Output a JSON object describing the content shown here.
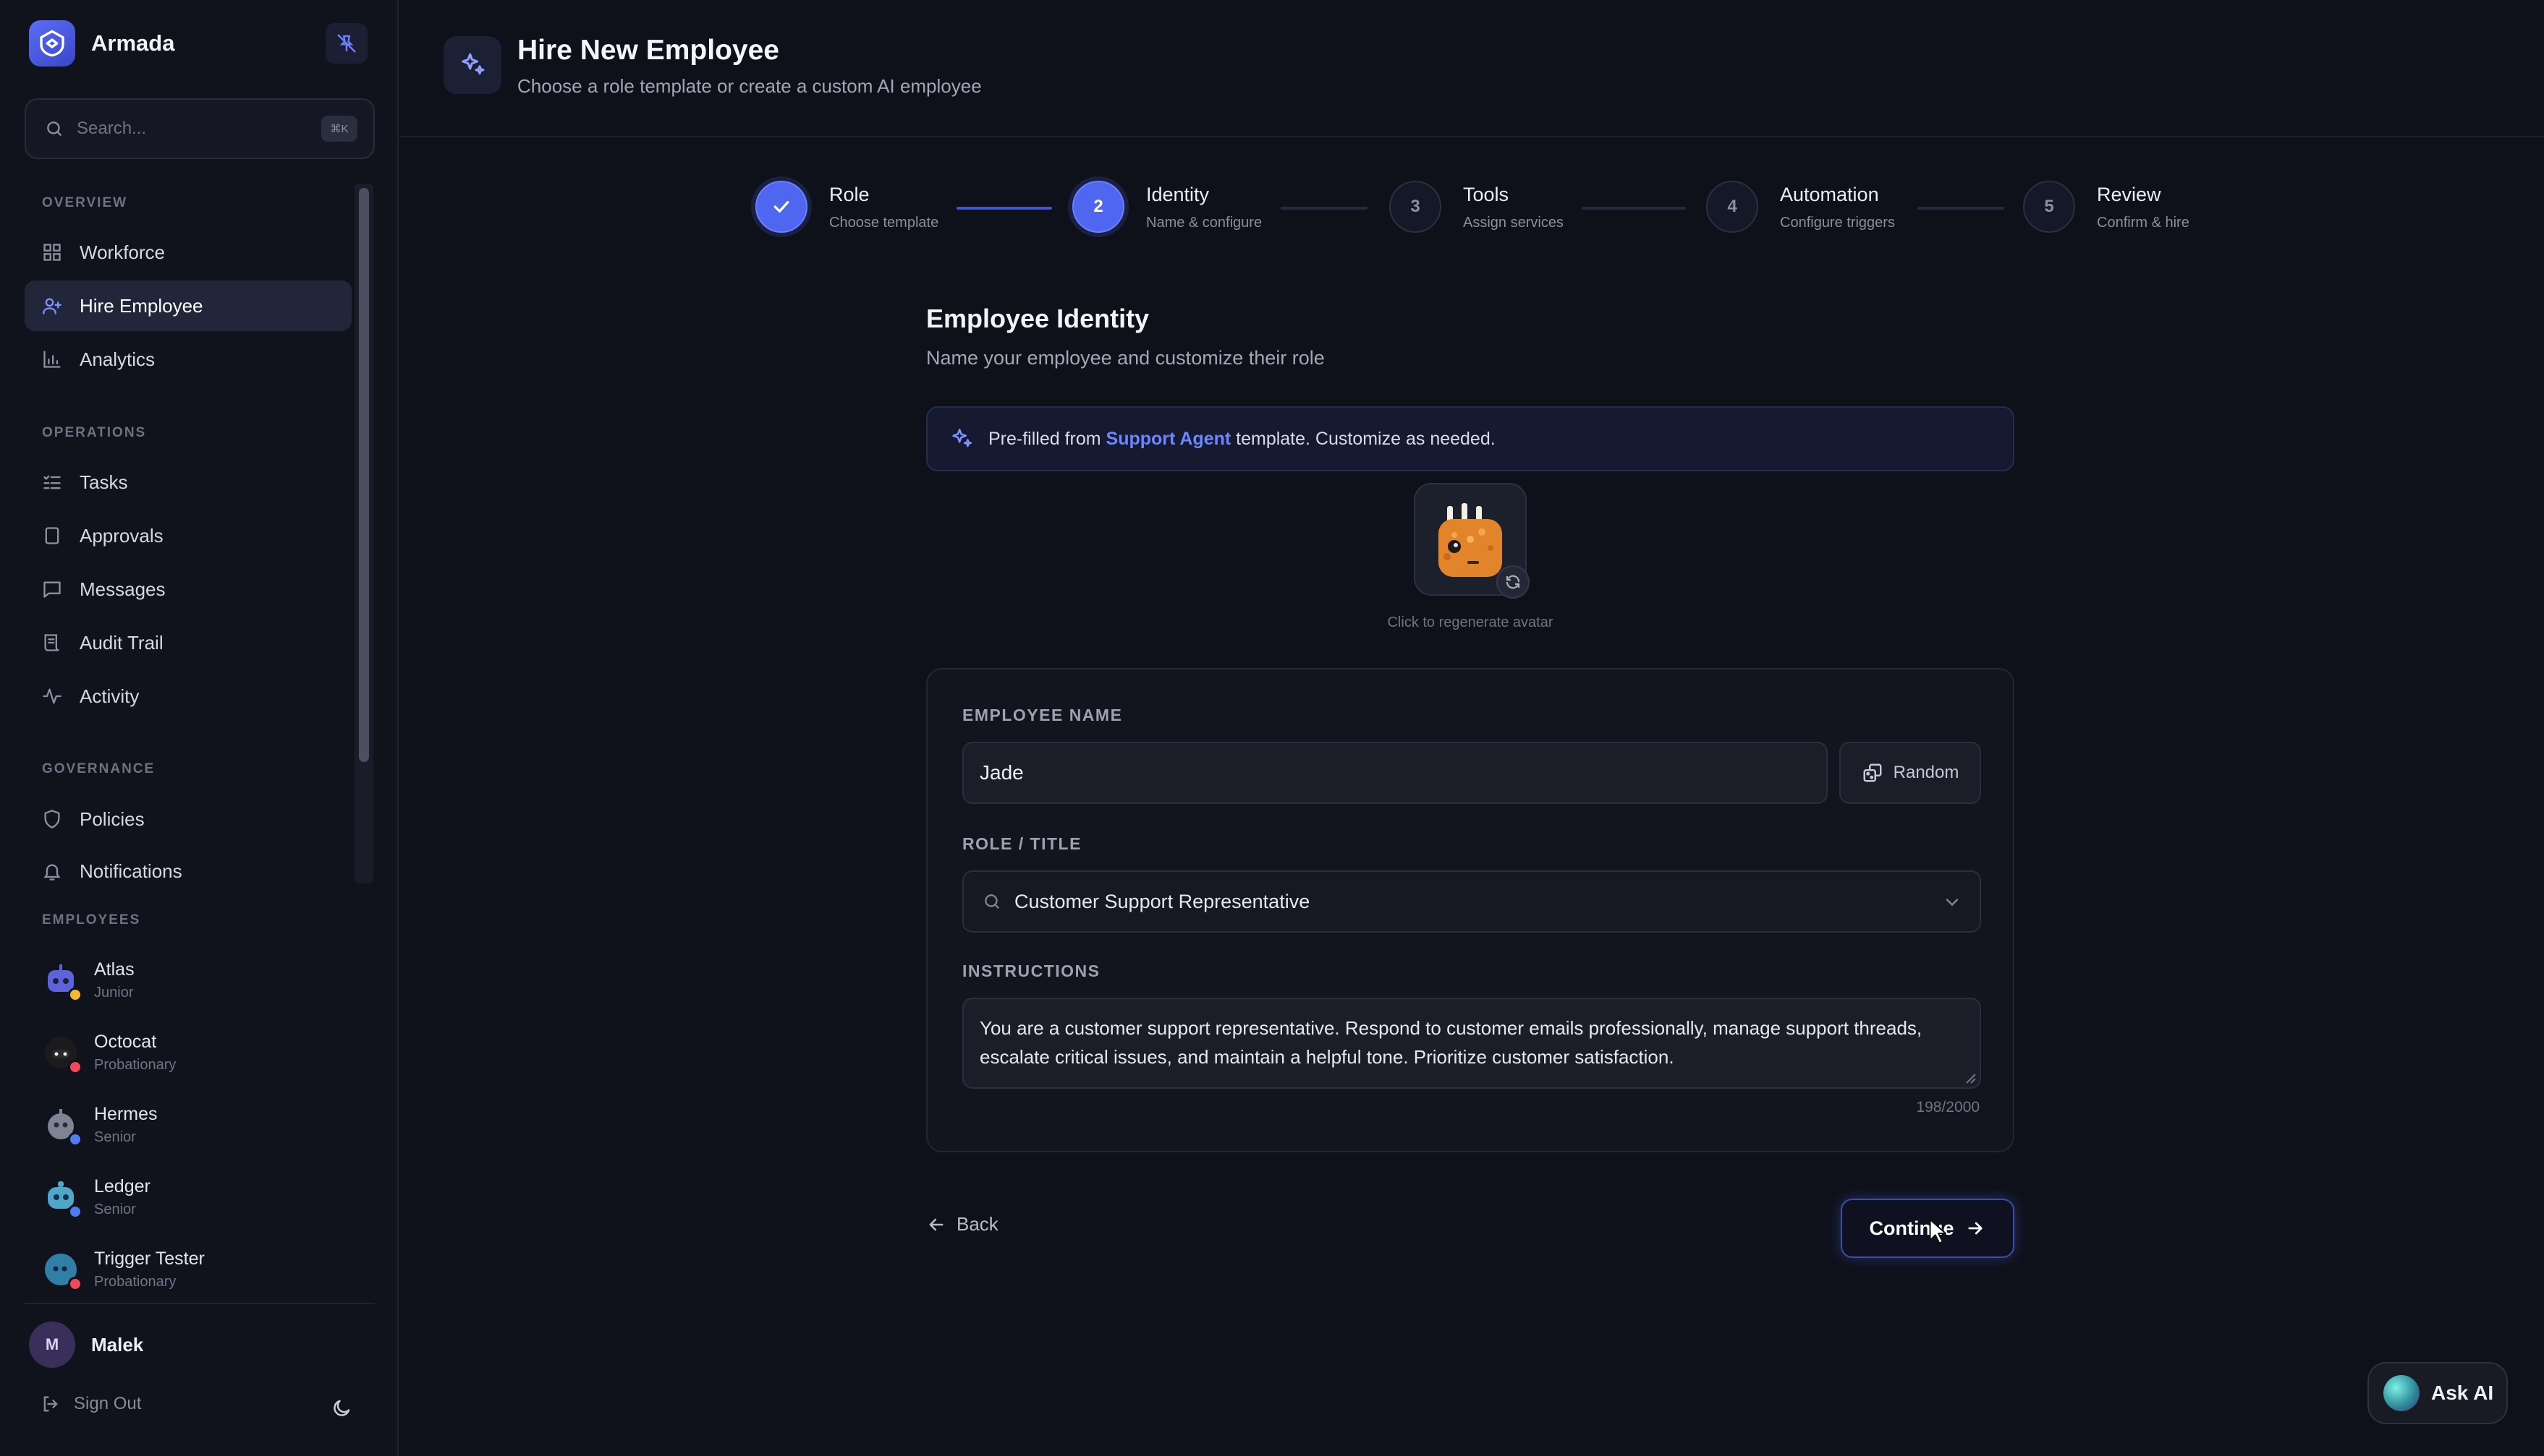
{
  "brand": {
    "name": "Armada"
  },
  "search": {
    "placeholder": "Search...",
    "shortcut": "⌘K"
  },
  "sidebar": {
    "sections": {
      "overview": "OVERVIEW",
      "operations": "OPERATIONS",
      "governance": "GOVERNANCE",
      "employees": "EMPLOYEES"
    },
    "overview_items": [
      {
        "label": "Workforce",
        "icon": "grid-icon"
      },
      {
        "label": "Hire Employee",
        "icon": "user-plus-icon",
        "active": true
      },
      {
        "label": "Analytics",
        "icon": "bar-chart-icon"
      }
    ],
    "operations_items": [
      {
        "label": "Tasks",
        "icon": "list-check-icon"
      },
      {
        "label": "Approvals",
        "icon": "clipboard-icon"
      },
      {
        "label": "Messages",
        "icon": "message-icon"
      },
      {
        "label": "Audit Trail",
        "icon": "scroll-icon"
      },
      {
        "label": "Activity",
        "icon": "activity-icon"
      }
    ],
    "governance_items": [
      {
        "label": "Policies",
        "icon": "shield-icon"
      },
      {
        "label": "Notifications",
        "icon": "bell-icon"
      }
    ],
    "employees": [
      {
        "name": "Atlas",
        "level": "Junior",
        "status_color": "#f5b731",
        "avatar_color": "#5d63d8"
      },
      {
        "name": "Octocat",
        "level": "Probationary",
        "status_color": "#ef4a55",
        "avatar_color": "#2a2a2a"
      },
      {
        "name": "Hermes",
        "level": "Senior",
        "status_color": "#4f7df0",
        "avatar_color": "#7d8494"
      },
      {
        "name": "Ledger",
        "level": "Senior",
        "status_color": "#4f7df0",
        "avatar_color": "#4ea6c8"
      },
      {
        "name": "Trigger Tester",
        "level": "Probationary",
        "status_color": "#ef4a55",
        "avatar_color": "#2f7fa6"
      }
    ],
    "user": {
      "initial": "M",
      "name": "Malek"
    },
    "sign_out": "Sign Out"
  },
  "header": {
    "title": "Hire New Employee",
    "subtitle": "Choose a role template or create a custom AI employee"
  },
  "stepper": [
    {
      "number": "",
      "title": "Role",
      "subtitle": "Choose template",
      "state": "done"
    },
    {
      "number": "2",
      "title": "Identity",
      "subtitle": "Name & configure",
      "state": "current"
    },
    {
      "number": "3",
      "title": "Tools",
      "subtitle": "Assign services",
      "state": "pending"
    },
    {
      "number": "4",
      "title": "Automation",
      "subtitle": "Configure triggers",
      "state": "pending"
    },
    {
      "number": "5",
      "title": "Review",
      "subtitle": "Confirm & hire",
      "state": "pending"
    }
  ],
  "identity": {
    "title": "Employee Identity",
    "subtitle": "Name your employee and customize their role",
    "banner": {
      "prefix": "Pre-filled from ",
      "template": "Support Agent",
      "suffix": " template. Customize as needed."
    },
    "avatar_caption": "Click to regenerate avatar",
    "name_label": "EMPLOYEE NAME",
    "name_value": "Jade",
    "random_label": "Random",
    "role_label": "ROLE / TITLE",
    "role_value": "Customer Support Representative",
    "instructions_label": "INSTRUCTIONS",
    "instructions_value": "You are a customer support representative. Respond to customer emails professionally, manage support threads, escalate critical issues, and maintain a helpful tone. Prioritize customer satisfaction.",
    "char_count": "198/2000"
  },
  "actions": {
    "back": "Back",
    "continue": "Continue"
  },
  "ask_ai": "Ask AI",
  "colors": {
    "accent": "#4f67f0",
    "link": "#6d86ff",
    "background": "#0f111a"
  }
}
